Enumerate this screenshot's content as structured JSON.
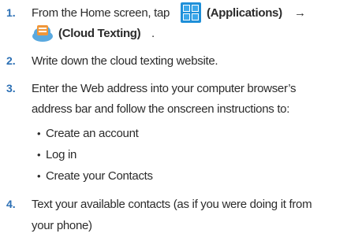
{
  "steps": [
    {
      "number": "1.",
      "line1_pre": "From the Home screen, tap",
      "line1_app": "(Applications)",
      "arrow": "→",
      "line2_app": "(Cloud Texting)",
      "line2_end": ".",
      "icons": [
        "applications-grid-icon",
        "cloud-texting-icon"
      ]
    },
    {
      "number": "2.",
      "text": "Write down the cloud texting website."
    },
    {
      "number": "3.",
      "line1": "Enter the Web address into your computer browser’s",
      "line2": "address bar and follow the onscreen instructions to:",
      "bullets": [
        "Create an account",
        "Log in",
        "Create your Contacts"
      ]
    },
    {
      "number": "4.",
      "line1": "Text your available contacts (as if you were doing it from",
      "line2": "your phone)"
    }
  ],
  "colors": {
    "number": "#2b6fb4",
    "text": "#2b2b2b",
    "app_icon": "#1e8fd8",
    "cloud_icon": "#5aa9df",
    "cloud_card": "#f0973a"
  }
}
